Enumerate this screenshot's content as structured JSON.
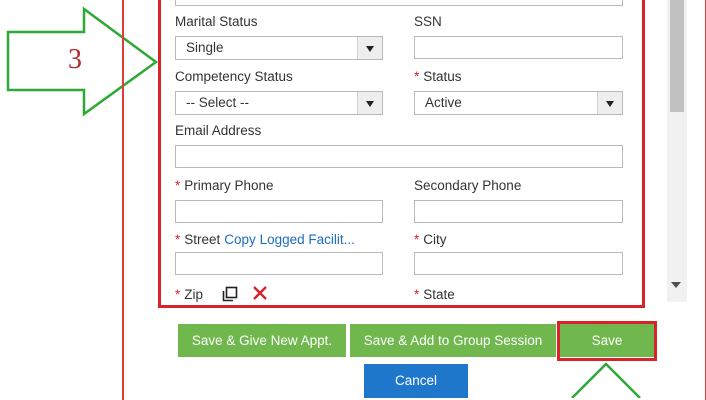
{
  "step_callout": {
    "number": "3"
  },
  "form": {
    "marital_status": {
      "label": "Marital Status",
      "value": "Single"
    },
    "ssn": {
      "label": "SSN",
      "value": ""
    },
    "competency_status": {
      "label": "Competency Status",
      "value": "-- Select --"
    },
    "status": {
      "required_mark": "*",
      "label": "Status",
      "value": "Active"
    },
    "email": {
      "label": "Email Address",
      "value": ""
    },
    "primary_phone": {
      "required_mark": "*",
      "label": "Primary Phone",
      "value": ""
    },
    "secondary_phone": {
      "label": "Secondary Phone",
      "value": ""
    },
    "street": {
      "required_mark": "*",
      "label": "Street",
      "link": "Copy Logged Facilit...",
      "value": ""
    },
    "city": {
      "required_mark": "*",
      "label": "City",
      "value": ""
    },
    "zip": {
      "required_mark": "*",
      "label": "Zip"
    },
    "state": {
      "required_mark": "*",
      "label": "State"
    }
  },
  "buttons": {
    "save_new_appt": "Save & Give New Appt.",
    "save_add_group": "Save & Add to Group Session",
    "save": "Save",
    "cancel": "Cancel"
  },
  "icons": {
    "zip_copy": "copy-icon",
    "zip_clear": "close-icon"
  },
  "colors": {
    "highlight_red": "#d9222a",
    "arrow_green": "#2ea836",
    "button_green": "#70b84e",
    "button_blue": "#1f77cc",
    "link_blue": "#1b6cc1"
  }
}
